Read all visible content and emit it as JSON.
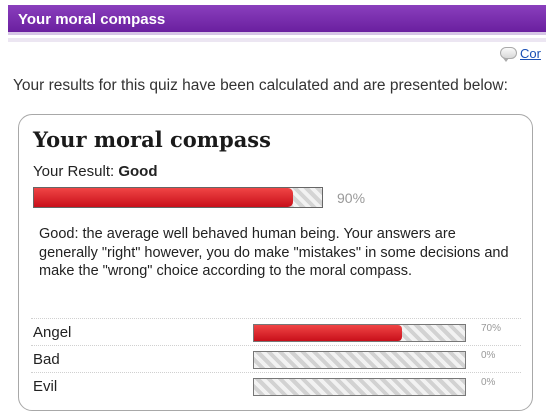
{
  "header": {
    "title": "Your moral compass"
  },
  "comment_link": {
    "icon": "comment-bubble-icon",
    "label": "Cor"
  },
  "intro_text": "Your results for this quiz have been calculated and are presented below:",
  "card": {
    "title": "Your moral compass",
    "result_prefix": "Your Result:",
    "result_value": "Good",
    "result_percent_value": 0.9,
    "result_percent_label": "90%",
    "description": "Good: the average well behaved human being. Your answers are generally \"right\" however, you do make \"mistakes\" in some decisions and make the \"wrong\" choice according to the moral compass.",
    "rows": [
      {
        "label": "Angel",
        "value": 0.7,
        "percent_label": "70%"
      },
      {
        "label": "Bad",
        "value": 0.0,
        "percent_label": "0%"
      },
      {
        "label": "Evil",
        "value": 0.0,
        "percent_label": "0%"
      }
    ]
  },
  "colors": {
    "header": "#6a1f9f",
    "bar_fill": "#d41620",
    "link": "#1a4fb5"
  }
}
